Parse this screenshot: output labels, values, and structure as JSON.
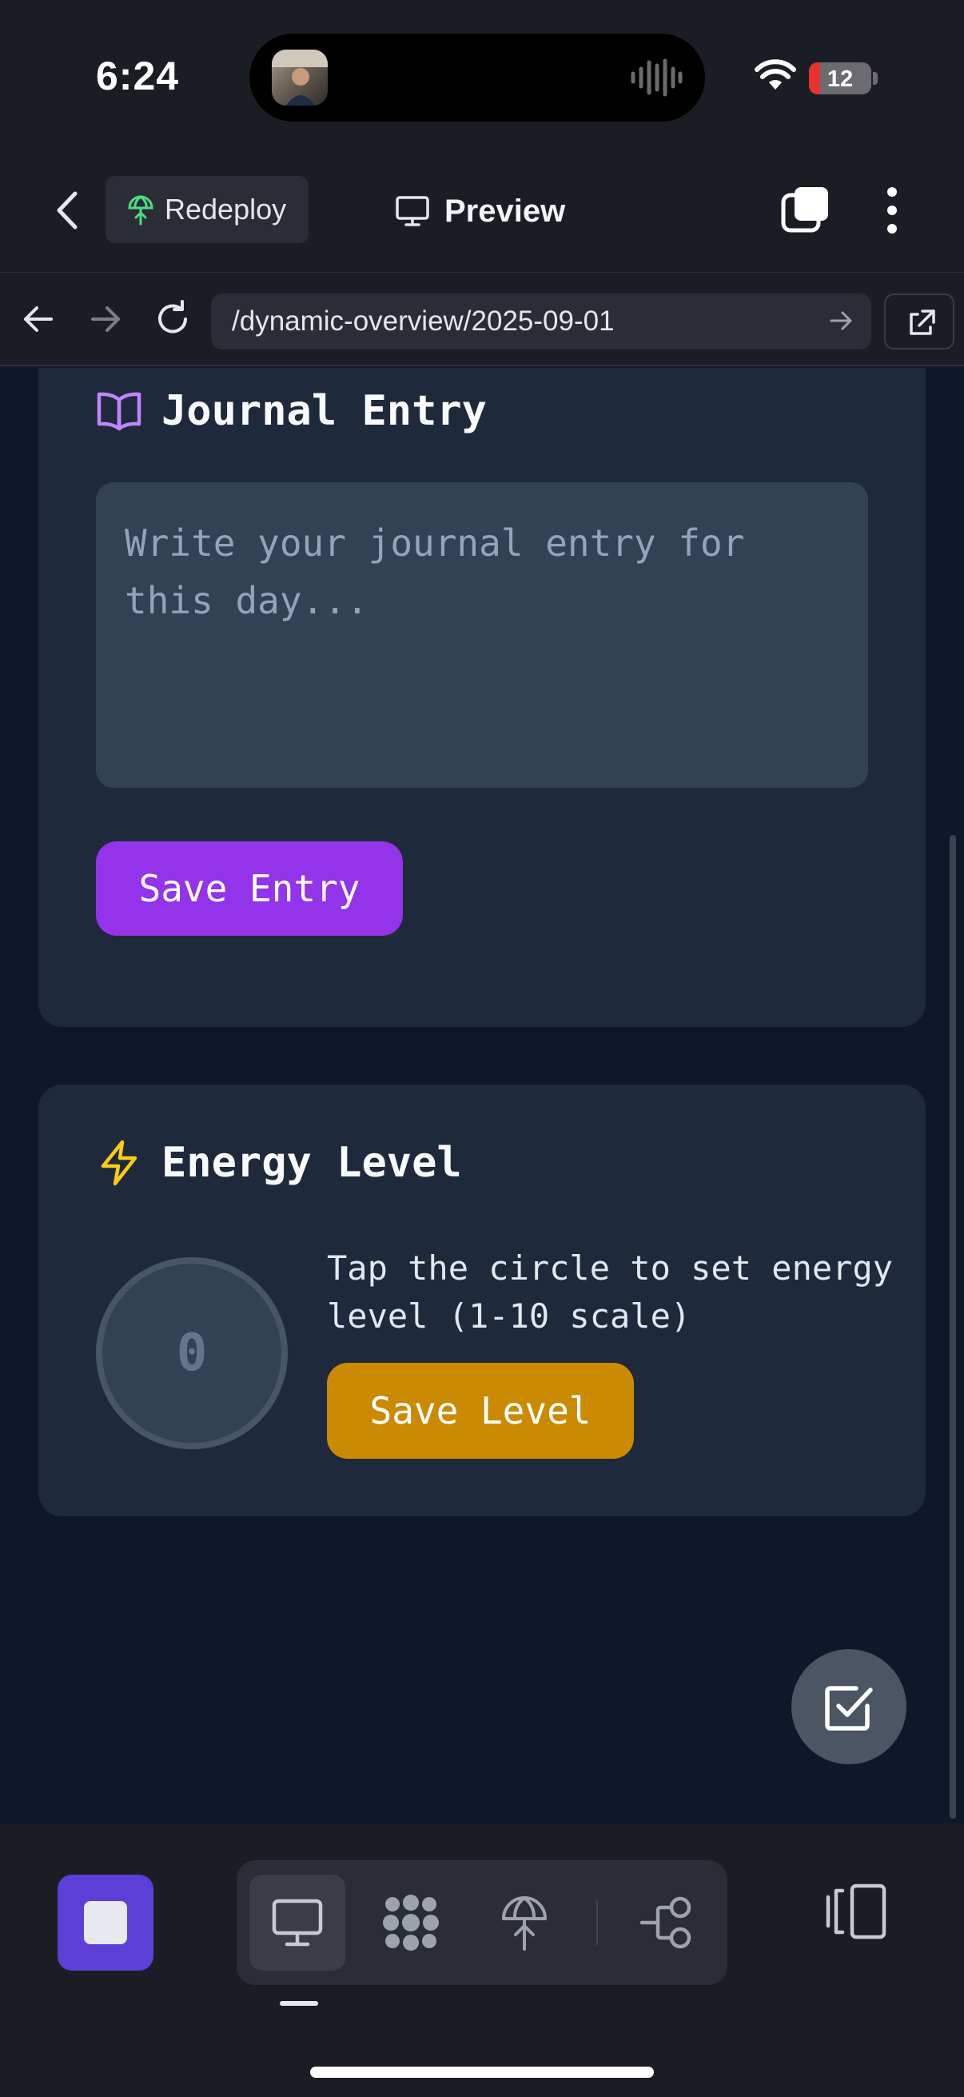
{
  "status_bar": {
    "time": "6:24",
    "battery": "12"
  },
  "header": {
    "redeploy_label": "Redeploy",
    "preview_label": "Preview"
  },
  "browser": {
    "url": "/dynamic-overview/2025-09-01"
  },
  "journal": {
    "title": "Journal Entry",
    "placeholder": "Write your journal entry for this day...",
    "save_label": "Save Entry"
  },
  "energy": {
    "title": "Energy Level",
    "value": "0",
    "hint": "Tap the circle to set energy level (1-10 scale)",
    "save_label": "Save Level"
  },
  "colors": {
    "journal_accent": "#9333ea",
    "journal_icon": "#c084fc",
    "energy_accent": "#ca8a04",
    "energy_icon": "#facc15",
    "stop_button": "#5b3fd6"
  },
  "bottom_bar": {
    "tools": [
      "desktop-icon",
      "dots-grid-icon",
      "deploy-icon",
      "flow-icon"
    ],
    "active_tool": "desktop-icon"
  }
}
